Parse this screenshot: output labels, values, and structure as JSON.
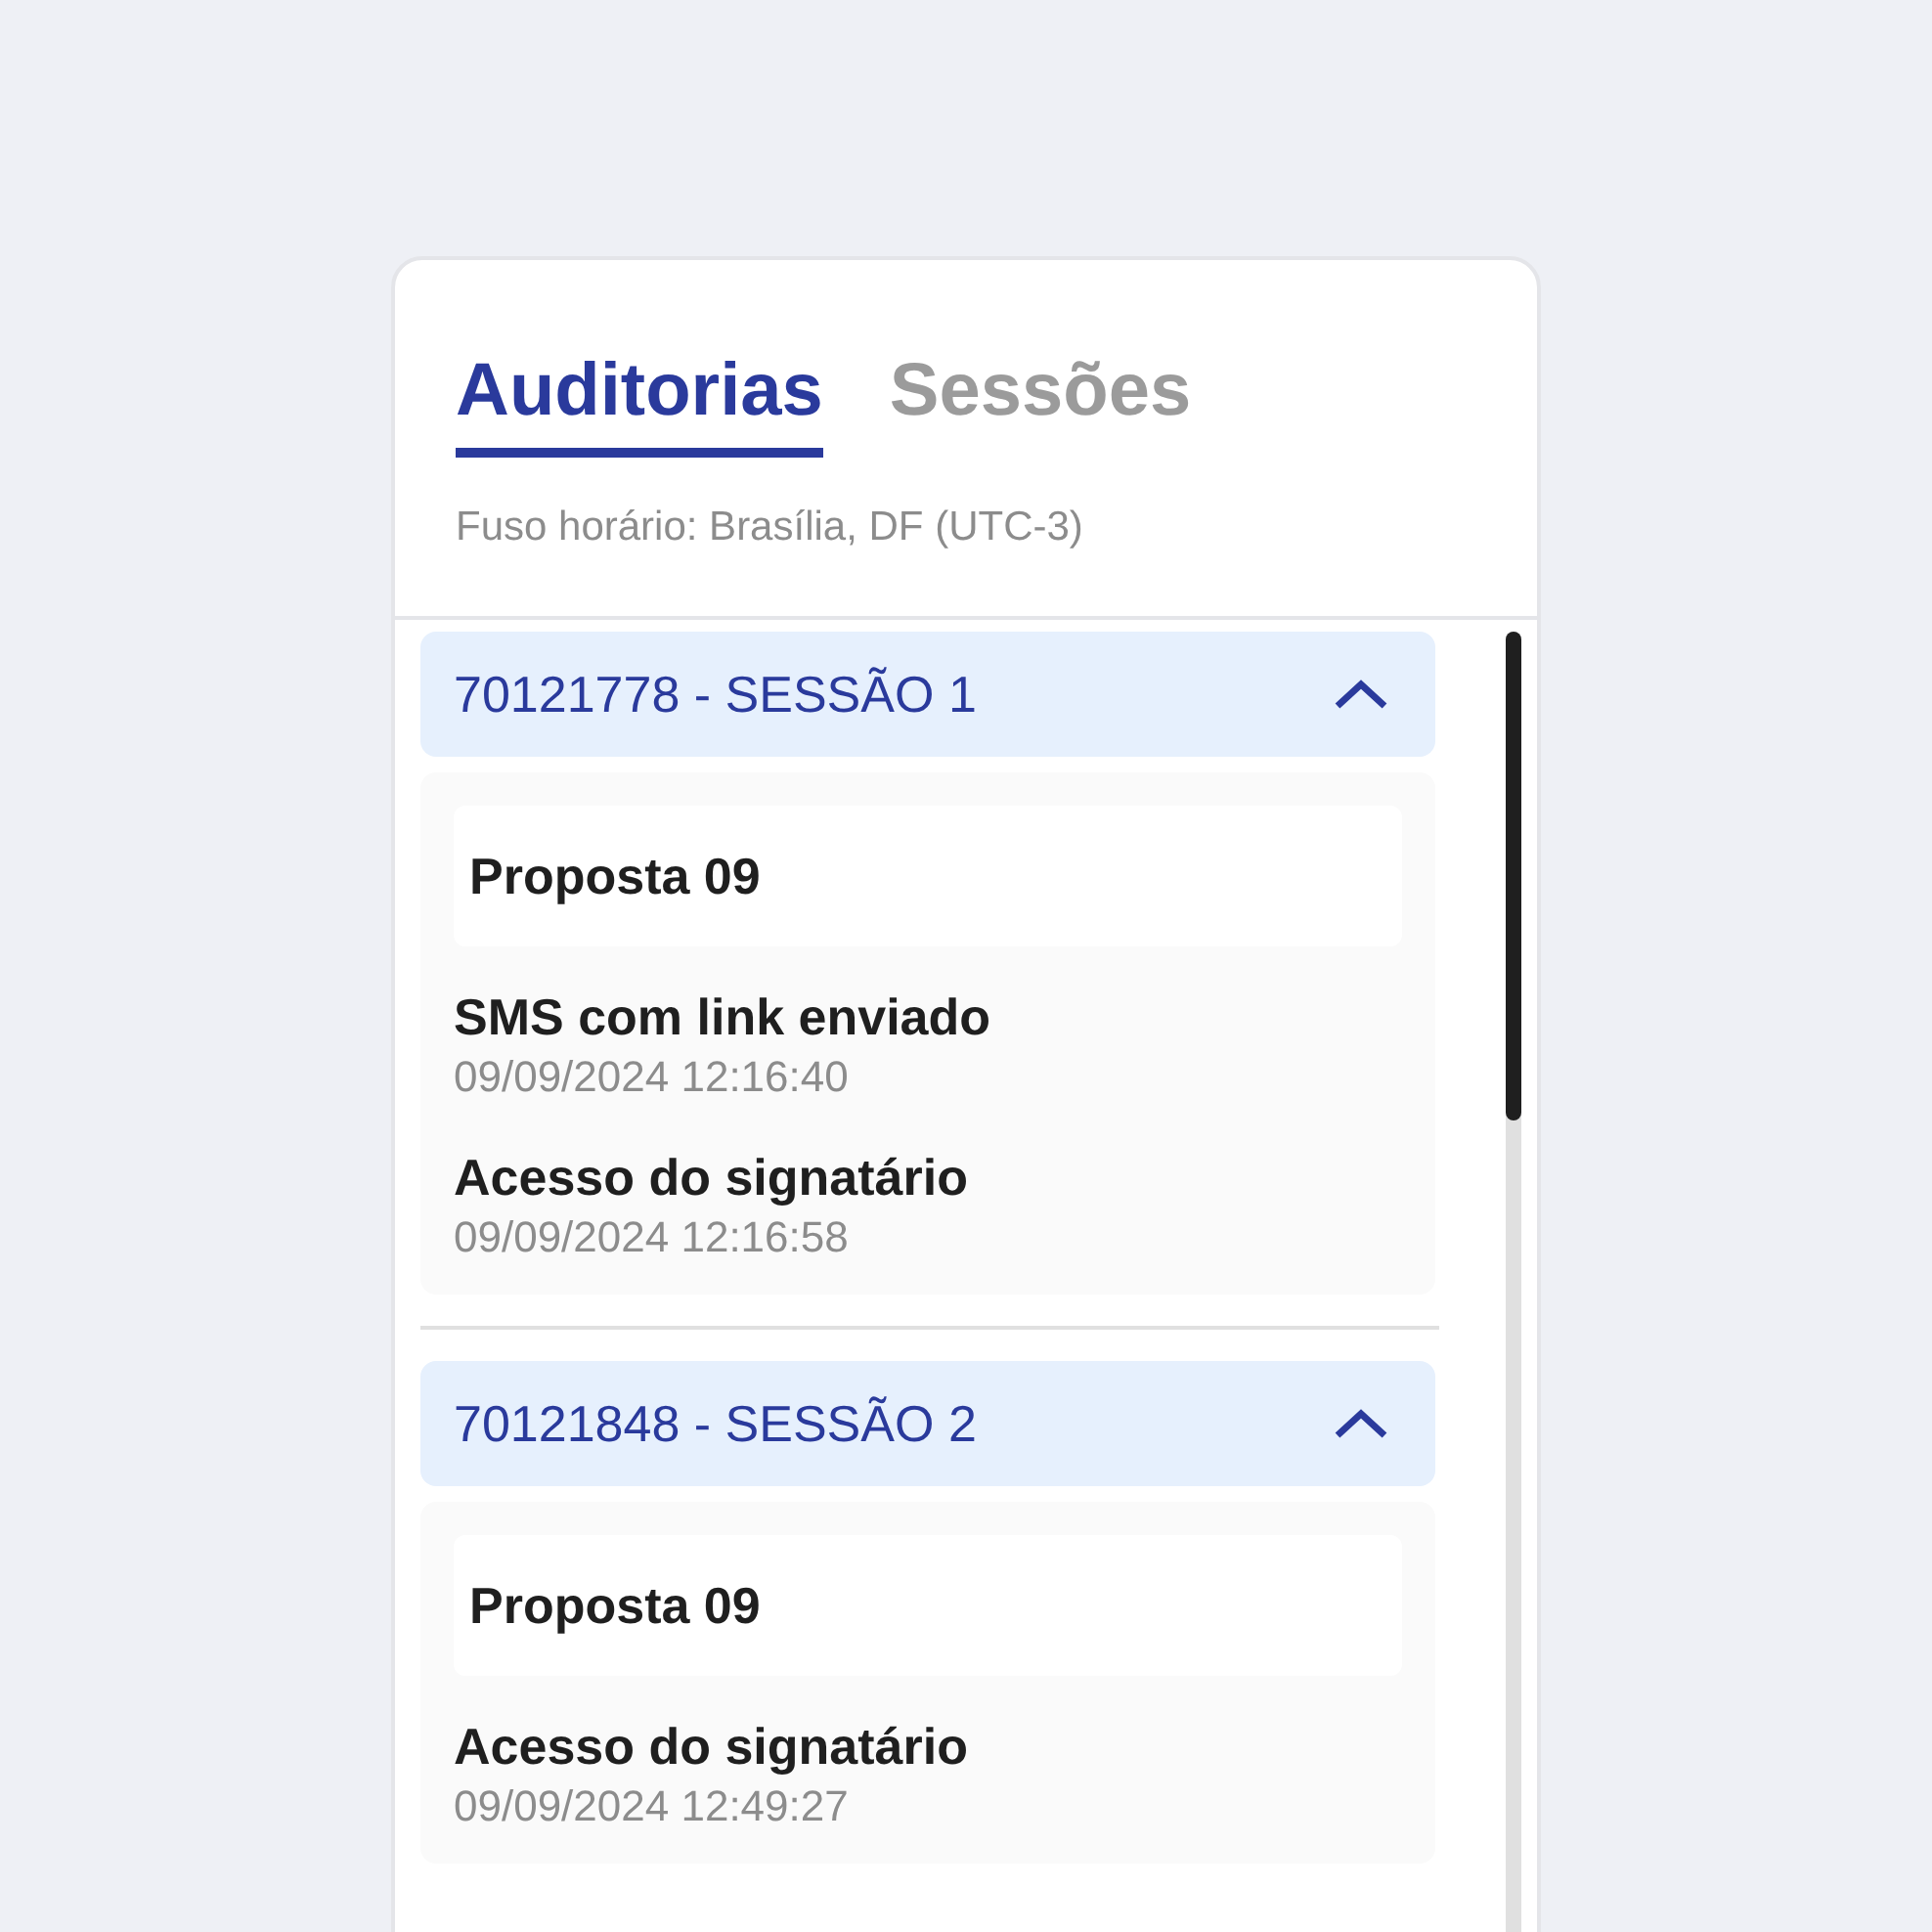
{
  "tabs": [
    {
      "label": "Auditorias",
      "selected": true
    },
    {
      "label": "Sessões",
      "selected": false
    }
  ],
  "timezone": "Fuso horário: Brasília, DF (UTC-3)",
  "sessions": [
    {
      "title": "70121778 - SESSÃO 1",
      "expanded": true,
      "proposal": "Proposta 09",
      "events": [
        {
          "title": "SMS com link enviado",
          "time": "09/09/2024 12:16:40"
        },
        {
          "title": "Acesso do signatário",
          "time": "09/09/2024 12:16:58"
        }
      ]
    },
    {
      "title": "70121848 - SESSÃO 2",
      "expanded": true,
      "proposal": "Proposta 09",
      "events": [
        {
          "title": "Acesso do signatário",
          "time": "09/09/2024 12:49:27"
        }
      ]
    }
  ]
}
